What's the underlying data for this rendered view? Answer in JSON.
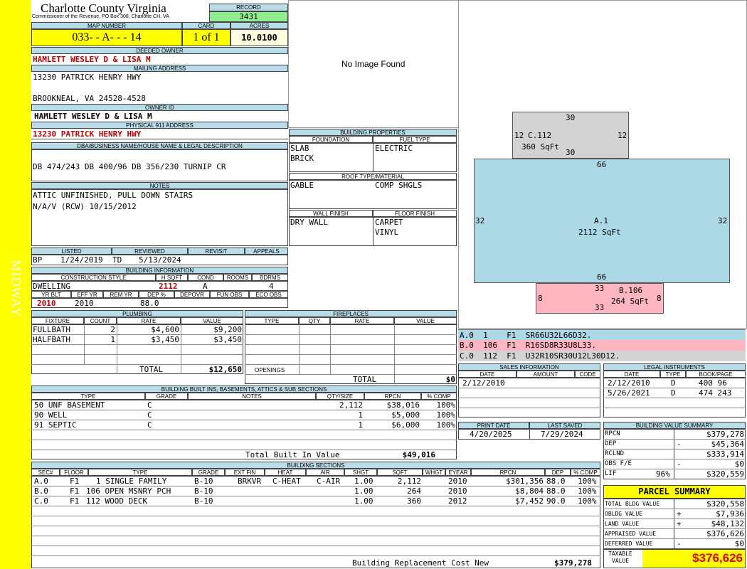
{
  "sidebar_label": "MIDWAY",
  "county": {
    "title": "Charlotte County Virginia",
    "subtitle": "Commissioner of the Revenue, PO Box 308, Charlotte CH, VA"
  },
  "record": {
    "label": "RECORD",
    "value": "3431"
  },
  "map": {
    "label": "MAP NUMBER",
    "value": "033- - A- - - 14"
  },
  "card": {
    "label": "CARD",
    "value": "1 of 1"
  },
  "acres": {
    "label": "ACRES",
    "value": "10.0100"
  },
  "owner": {
    "deeded_label": "DEEDED OWNER",
    "deeded": "HAMLETT WESLEY D & LISA M",
    "mailing_label": "MAILING ADDRESS",
    "mail1": "13230 PATRICK HENRY HWY",
    "mail2": "BROOKNEAL, VA 24528-4528",
    "ownerid_label": "OWNER ID",
    "ownerid": "HAMLETT WESLEY D & LISA M",
    "phys_label": "PHYSICAL 911 ADDRESS",
    "phys": "13230 PATRICK HENRY HWY"
  },
  "legal": {
    "label": "DBA/BUSINESS NAME/HOUSE NAME & LEGAL DESCRIPTION",
    "value": "DB 474/243 DB 400/96 DB 356/230 TURNIP CR"
  },
  "notes": {
    "label": "NOTES",
    "line1": "ATTIC UNFINISHED, PULL DOWN STAIRS",
    "line2": "N/A/V (RCW) 10/15/2012"
  },
  "image_msg": "No Image Found",
  "listed": {
    "listed_label": "LISTED",
    "reviewed_label": "REVIEWED",
    "revisit_label": "REVISIT",
    "appeals_label": "APPEALS",
    "l_code": "BP",
    "l_date": "1/24/2019",
    "r_code": "TD",
    "r_date": "5/13/2024"
  },
  "building_info": {
    "label": "BUILDING INFORMATION",
    "h_style": "CONSTRUCTION STYLE",
    "h_hsqft": "H SQFT",
    "h_cond": "COND",
    "h_rooms": "ROOMS",
    "h_bdrms": "BDRMS",
    "style": "DWELLING",
    "hsqft": "2112",
    "cond": "A",
    "rooms": "",
    "bdrms": "4",
    "h_yrblt": "YR BLT",
    "h_effyr": "EFF YR",
    "h_remyr": "REM YR",
    "h_dep": "DEP %",
    "h_depovr": "DEPOVR",
    "h_funobs": "FUN OBS",
    "h_ecoobs": "ECO OBS",
    "yrblt": "2010",
    "effyr": "2010",
    "dep": "88.0"
  },
  "bldg_props": {
    "label": "BUILDING PROPERTIES",
    "foundation_label": "FOUNDATION",
    "fuel_label": "FUEL TYPE",
    "foundation1": "SLAB",
    "foundation2": "BRICK",
    "fuel": "ELECTRIC",
    "roof_label": "ROOF TYPE/MATERIAL",
    "roof1": "GABLE",
    "roof2": "COMP SHGLS",
    "wall_label": "WALL FINISH",
    "floor_label": "FLOOR FINISH",
    "wall": "DRY WALL",
    "floor1": "CARPET",
    "floor2": "VINYL"
  },
  "sketch": {
    "c_label": "C.112",
    "c_area": "360 SqFt",
    "a_label": "A.1",
    "a_area": "2112 SqFt",
    "b_label": "B.106",
    "b_area": "264 SqFt",
    "d30": "30",
    "d12": "12",
    "d66": "66",
    "d32": "32",
    "d33": "33",
    "d8": "8",
    "color_a": "#add8e6",
    "color_b": "#ffb6c1",
    "color_c": "#d3d3d3"
  },
  "sketch_codes": [
    {
      "text": "A.0  1    F1  SR66U32L66D32.",
      "color": "#add8e6"
    },
    {
      "text": "B.0  106  F1  R16SD8R33U8L33.",
      "color": "#ffb6c1"
    },
    {
      "text": "C.0  112  F1  U32R10SR30U12L30D12.",
      "color": "#d3d3d3"
    }
  ],
  "plumbing": {
    "label": "PLUMBING",
    "h_fixture": "FIXTURE",
    "h_count": "COUNT",
    "h_rate": "RATE",
    "h_value": "VALUE",
    "rows": [
      {
        "fixture": "FULLBATH",
        "count": "2",
        "rate": "$4,600",
        "value": "$9,200"
      },
      {
        "fixture": "HALFBATH",
        "count": "1",
        "rate": "$3,450",
        "value": "$3,450"
      }
    ],
    "total_label": "TOTAL",
    "total": "$12,650"
  },
  "fireplaces": {
    "label": "FIREPLACES",
    "h_type": "TYPE",
    "h_qty": "QTY",
    "h_rate": "RATE",
    "h_value": "VALUE",
    "openings_label": "OPENINGS",
    "total_label": "TOTAL",
    "total": "$0"
  },
  "sales": {
    "label": "SALES INFORMATION",
    "h_date": "DATE",
    "h_amount": "AMOUNT",
    "h_code": "CODE",
    "date1": "2/12/2010"
  },
  "legal_instr": {
    "label": "LEGAL INSTRUMENTS",
    "h_date": "DATE",
    "h_type": "TYPE",
    "h_book": "BOOK/PAGE",
    "rows": [
      {
        "date": "2/12/2010",
        "type": "D",
        "book": "400 96"
      },
      {
        "date": "5/26/2021",
        "type": "D",
        "book": "474 243"
      }
    ]
  },
  "built_ins": {
    "label": "BUILDING BUILT INS, BASEMENTS, ATTICS & SUB SECTIONS",
    "h_type": "TYPE",
    "h_grade": "GRADE",
    "h_notes": "NOTES",
    "h_qty": "QTY/SIZE",
    "h_rpcn": "RPCN",
    "h_comp": "% COMP",
    "rows": [
      {
        "type": "50 UNF BASEMENT",
        "grade": "C",
        "qty": "2,112",
        "rpcn": "$38,016",
        "comp": "100%"
      },
      {
        "type": "90 WELL",
        "grade": "C",
        "qty": "1",
        "rpcn": "$5,000",
        "comp": "100%"
      },
      {
        "type": "91 SEPTIC",
        "grade": "C",
        "qty": "1",
        "rpcn": "$6,000",
        "comp": "100%"
      }
    ],
    "total_label": "Total Built In Value",
    "total": "$49,016"
  },
  "print": {
    "print_label": "PRINT DATE",
    "saved_label": "LAST SAVED",
    "print_date": "4/20/2025",
    "saved_date": "7/29/2024"
  },
  "bvs": {
    "label": "BUILDING VALUE SUMMARY",
    "rows": [
      {
        "label": "RPCN",
        "sign": "",
        "pct": "",
        "value": "$379,278"
      },
      {
        "label": "DEP",
        "sign": "-",
        "pct": "",
        "value": "$45,364"
      },
      {
        "label": "RCLND",
        "sign": "",
        "pct": "",
        "value": "$333,914"
      },
      {
        "label": "OBS F/E",
        "sign": "-",
        "pct": "",
        "value": "$0"
      },
      {
        "label": "LIF",
        "sign": "",
        "pct": "96%",
        "value": "$320,559"
      }
    ]
  },
  "sections": {
    "label": "BUILDING SECTIONS",
    "h_sec": "SEC#",
    "h_floor": "FLOOR",
    "h_type": "TYPE",
    "h_grade": "GRADE",
    "h_extfin": "EXT FIN",
    "h_heat": "HEAT",
    "h_air": "AIR",
    "h_shgt": "SHGT",
    "h_sqft": "SQFT",
    "h_whgt": "WHGT",
    "h_eyear": "EYEAR",
    "h_rpcn": "RPCN",
    "h_dep": "DEP",
    "h_comp": "% COMP",
    "rows": [
      {
        "sec": "A.0",
        "floor": "F1",
        "type": "1 SINGLE FAMILY",
        "grade": "B-10",
        "extfin": "BRKVR",
        "heat": "C-HEAT",
        "air": "C-AIR",
        "shgt": "1.00",
        "sqft": "2,112",
        "eyear": "2010",
        "rpcn": "$301,356",
        "dep": "88.0",
        "comp": "100%"
      },
      {
        "sec": "B.0",
        "floor": "F1",
        "type": "106 OPEN MSNRY PCH",
        "grade": "B-10",
        "extfin": "",
        "heat": "",
        "air": "",
        "shgt": "1.00",
        "sqft": "264",
        "eyear": "2010",
        "rpcn": "$8,804",
        "dep": "88.0",
        "comp": "100%"
      },
      {
        "sec": "C.0",
        "floor": "F1",
        "type": "112 WOOD DECK",
        "grade": "B-10",
        "extfin": "",
        "heat": "",
        "air": "",
        "shgt": "1.00",
        "sqft": "360",
        "eyear": "2012",
        "rpcn": "$7,452",
        "dep": "90.0",
        "comp": "100%"
      }
    ],
    "total_label": "Building Replacement Cost New",
    "total": "$379,278"
  },
  "parcel": {
    "label": "PARCEL SUMMARY",
    "rows": [
      {
        "label": "TOTAL BLDG VALUE",
        "sign": "",
        "value": "$320,558"
      },
      {
        "label": "OBLDG VALUE",
        "sign": "+",
        "value": "$7,936"
      },
      {
        "label": "LAND VALUE",
        "sign": "+",
        "value": "$48,132"
      },
      {
        "label": "APPRAISED VALUE",
        "sign": "",
        "value": "$376,626"
      },
      {
        "label": "DEFERRED VALUE",
        "sign": "-",
        "value": "$0"
      }
    ],
    "taxable_label1": "TAXABLE",
    "taxable_label2": "VALUE",
    "taxable": "$376,626"
  }
}
